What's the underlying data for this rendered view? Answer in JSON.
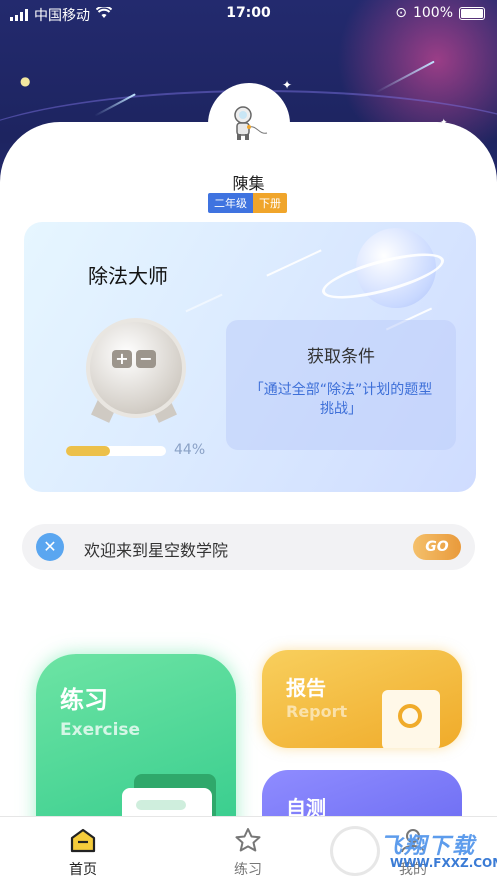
{
  "status_bar": {
    "carrier": "中国移动",
    "time": "17:00",
    "battery": "100%"
  },
  "profile": {
    "name": "陳集",
    "grade": "二年级",
    "term": "下册"
  },
  "badge": {
    "title": "除法大师",
    "progress_percent": 44,
    "progress_text": "44%",
    "condition_title": "获取条件",
    "condition_desc": "「通过全部“除法”计划的题型挑战」"
  },
  "welcome": {
    "text": "欢迎来到星空数学院",
    "go_label": "GO"
  },
  "cards": {
    "exercise": {
      "title": "练习",
      "subtitle": "Exercise"
    },
    "report": {
      "title": "报告",
      "subtitle": "Report"
    },
    "self_test": {
      "title": "自测"
    }
  },
  "tabs": [
    {
      "label": "首页",
      "icon": "home-icon"
    },
    {
      "label": "练习",
      "icon": "star-icon"
    },
    {
      "label": "我的",
      "icon": "user-icon"
    }
  ],
  "watermark": {
    "brand": "飞翔下载",
    "url": "WWW.FXXZ.COM"
  },
  "colors": {
    "accent_green": "#2fc98a",
    "accent_yellow": "#f0ab2a",
    "accent_purple": "#6c6cf2",
    "link_blue": "#3d6fd8"
  }
}
